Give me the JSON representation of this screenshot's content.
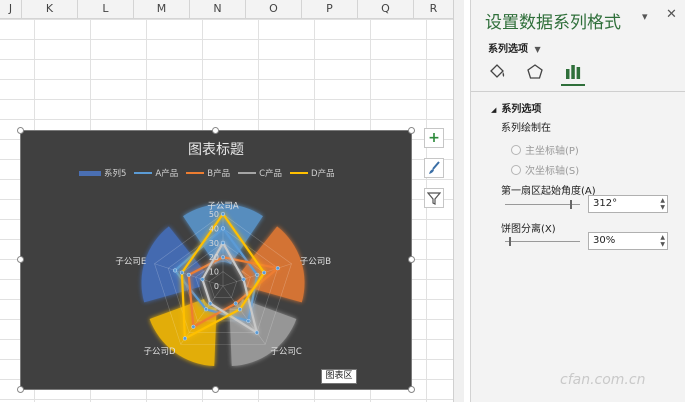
{
  "spreadsheet": {
    "columns": [
      "J",
      "K",
      "L",
      "M",
      "N",
      "O",
      "P",
      "Q",
      "R"
    ]
  },
  "chart": {
    "title": "图表标题",
    "legend": [
      {
        "name": "系列5",
        "color": "#4a6fb3",
        "kind": "bar"
      },
      {
        "name": "A产品",
        "color": "#5b9bd5",
        "kind": "line"
      },
      {
        "name": "B产品",
        "color": "#ed7d31",
        "kind": "line"
      },
      {
        "name": "C产品",
        "color": "#a5a5a5",
        "kind": "line"
      },
      {
        "name": "D产品",
        "color": "#ffc000",
        "kind": "line"
      }
    ],
    "categories": [
      "子公司A",
      "子公司B",
      "子公司C",
      "子公司D",
      "子公司E"
    ],
    "axis_ticks": [
      "50",
      "40",
      "30",
      "20",
      "10",
      "0"
    ],
    "tooltip": "图表区"
  },
  "chart_data": {
    "type": "radar",
    "categories": [
      "子公司A",
      "子公司B",
      "子公司C",
      "子公司D",
      "子公司E"
    ],
    "ylim": [
      0,
      50
    ],
    "series": [
      {
        "name": "A产品",
        "values": [
          40,
          25,
          30,
          20,
          35
        ]
      },
      {
        "name": "B产品",
        "values": [
          20,
          40,
          15,
          35,
          25
        ]
      },
      {
        "name": "C产品",
        "values": [
          30,
          15,
          40,
          15,
          15
        ]
      },
      {
        "name": "D产品",
        "values": [
          50,
          30,
          20,
          45,
          30
        ]
      }
    ]
  },
  "side_buttons": {
    "add": "+",
    "style": "brush-icon",
    "filter": "filter-icon"
  },
  "pane": {
    "title": "设置数据系列格式",
    "subtitle": "系列选项",
    "section": "系列选项",
    "plot_on": "系列绘制在",
    "primary_axis": "主坐标轴(P)",
    "secondary_axis": "次坐标轴(S)",
    "first_slice_angle_label": "第一扇区起始角度(A)",
    "first_slice_angle_value": "312°",
    "first_slice_angle_fraction": 0.87,
    "explosion_label": "饼图分离(X)",
    "explosion_value": "30%",
    "explosion_fraction": 0.05
  },
  "watermark": "cfan.com.cn"
}
